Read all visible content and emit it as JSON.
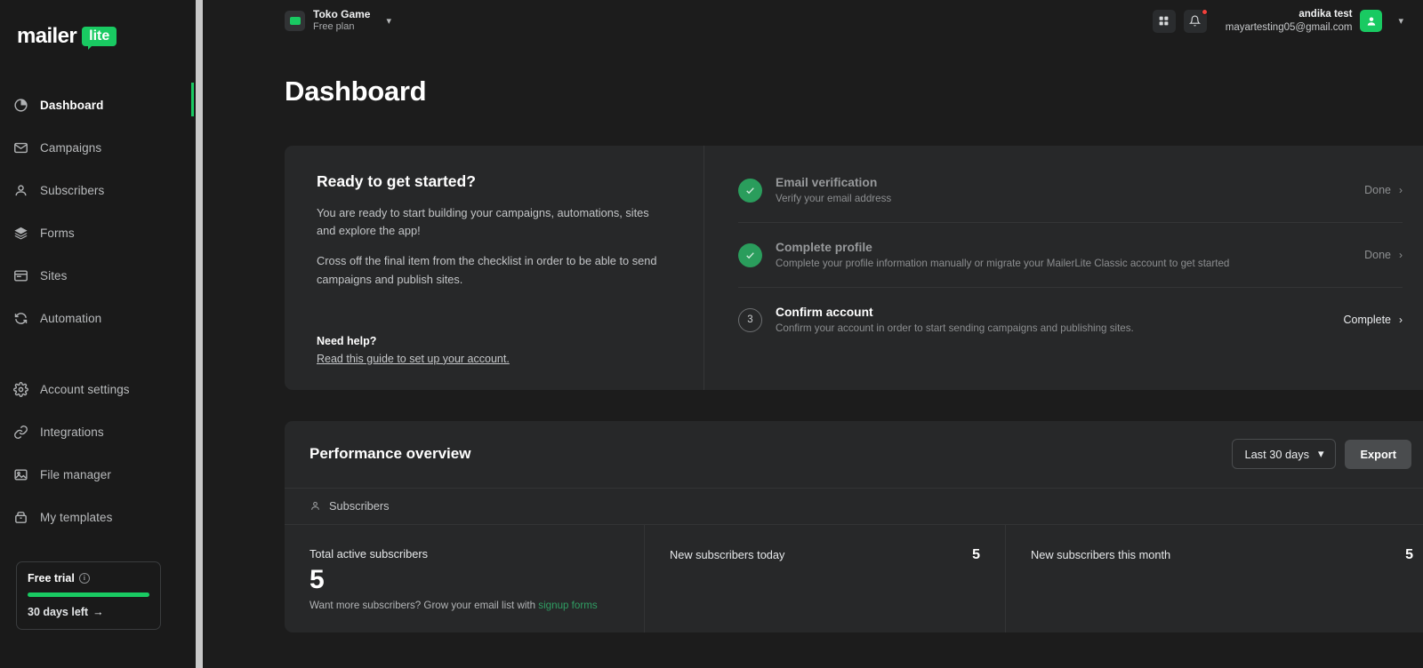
{
  "brand": {
    "logo_main": "mailer",
    "logo_badge": "lite",
    "accent": "#19ca62"
  },
  "sidebar": {
    "items": [
      {
        "label": "Dashboard",
        "icon": "pie-chart-icon",
        "active": true
      },
      {
        "label": "Campaigns",
        "icon": "envelope-icon",
        "active": false
      },
      {
        "label": "Subscribers",
        "icon": "user-icon",
        "active": false
      },
      {
        "label": "Forms",
        "icon": "layers-icon",
        "active": false
      },
      {
        "label": "Sites",
        "icon": "browser-window-icon",
        "active": false
      },
      {
        "label": "Automation",
        "icon": "refresh-icon",
        "active": false
      },
      {
        "label": "Account settings",
        "icon": "gear-icon",
        "active": false
      },
      {
        "label": "Integrations",
        "icon": "link-icon",
        "active": false
      },
      {
        "label": "File manager",
        "icon": "image-icon",
        "active": false
      },
      {
        "label": "My templates",
        "icon": "archive-icon",
        "active": false
      }
    ],
    "trial": {
      "title": "Free trial",
      "progress_percent": 100,
      "days_left": "30 days left",
      "arrow": "→"
    }
  },
  "topbar": {
    "workspace_name": "Toko Game",
    "workspace_plan": "Free plan",
    "apps_icon": "grid-apps-icon",
    "notifications_icon": "bell-icon",
    "has_notification": true,
    "user_name": "andika test",
    "user_email": "mayartesting05@gmail.com"
  },
  "page": {
    "title": "Dashboard"
  },
  "checklist_card": {
    "heading": "Ready to get started?",
    "paragraph1": "You are ready to start building your campaigns, automations, sites and explore the app!",
    "paragraph2": "Cross off the final item from the checklist in order to be able to send campaigns and publish sites.",
    "help_title": "Need help?",
    "help_link": "Read this guide to set up your account.",
    "tasks": [
      {
        "name": "Email verification",
        "desc": "Verify your email address",
        "action": "Done",
        "state": "done",
        "marker": "✓"
      },
      {
        "name": "Complete profile",
        "desc": "Complete your profile information manually or migrate your MailerLite Classic account to get started",
        "action": "Done",
        "state": "done",
        "marker": "✓"
      },
      {
        "name": "Confirm account",
        "desc": "Confirm your account in order to start sending campaigns and publishing sites.",
        "action": "Complete",
        "state": "pending",
        "marker": "3"
      }
    ]
  },
  "performance": {
    "title": "Performance overview",
    "range_label": "Last 30 days",
    "export_label": "Export",
    "section_label": "Subscribers",
    "stats": [
      {
        "label": "Total active subscribers",
        "value": "5",
        "foot_prefix": "Want more subscribers? Grow your email list with ",
        "foot_link": "signup forms"
      },
      {
        "label": "New subscribers today",
        "value": "5"
      },
      {
        "label": "New subscribers this month",
        "value": "5"
      }
    ]
  }
}
